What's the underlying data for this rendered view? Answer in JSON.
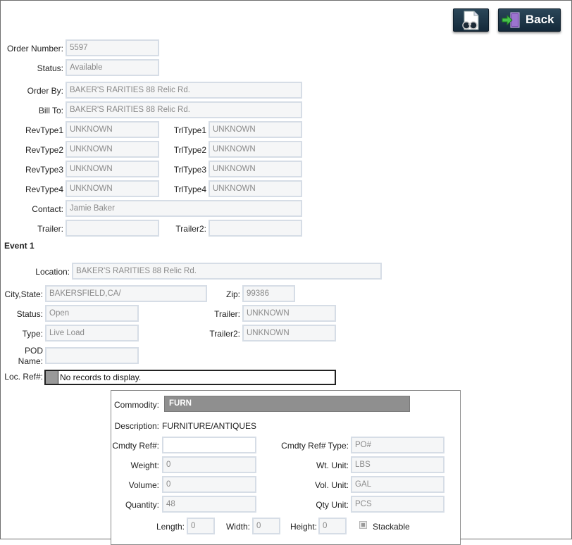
{
  "toolbar": {
    "view_icon": "binoculars-document-icon",
    "back_label": "Back",
    "back_icon": "exit-door-icon"
  },
  "order": {
    "order_number": {
      "label": "Order Number:",
      "value": "5597"
    },
    "status": {
      "label": "Status:",
      "value": "Available"
    },
    "order_by": {
      "label": "Order By:",
      "value": "BAKER'S RARITIES 88 Relic Rd."
    },
    "bill_to": {
      "label": "Bill To:",
      "value": "BAKER'S RARITIES 88 Relic Rd."
    },
    "revtype1": {
      "label": "RevType1",
      "value": "UNKNOWN"
    },
    "revtype2": {
      "label": "RevType2",
      "value": "UNKNOWN"
    },
    "revtype3": {
      "label": "RevType3",
      "value": "UNKNOWN"
    },
    "revtype4": {
      "label": "RevType4",
      "value": "UNKNOWN"
    },
    "trltype1": {
      "label": "TrlType1",
      "value": "UNKNOWN"
    },
    "trltype2": {
      "label": "TrlType2",
      "value": "UNKNOWN"
    },
    "trltype3": {
      "label": "TrlType3",
      "value": "UNKNOWN"
    },
    "trltype4": {
      "label": "TrlType4",
      "value": "UNKNOWN"
    },
    "contact": {
      "label": "Contact:",
      "value": "Jamie Baker"
    },
    "trailer": {
      "label": "Trailer:",
      "value": ""
    },
    "trailer2": {
      "label": "Trailer2:",
      "value": ""
    }
  },
  "event": {
    "title": "Event 1",
    "location": {
      "label": "Location:",
      "value": "BAKER'S RARITIES 88 Relic Rd."
    },
    "city_state": {
      "label": "City,State:",
      "value": "BAKERSFIELD,CA/"
    },
    "zip": {
      "label": "Zip:",
      "value": "99386"
    },
    "status": {
      "label": "Status:",
      "value": "Open"
    },
    "trailer": {
      "label": "Trailer:",
      "value": "UNKNOWN"
    },
    "type": {
      "label": "Type:",
      "value": "Live Load"
    },
    "trailer2": {
      "label": "Trailer2:",
      "value": "UNKNOWN"
    },
    "pod_name": {
      "label_line1": "POD",
      "label_line2": "Name:",
      "value": ""
    },
    "loc_ref": {
      "label": "Loc. Ref#:",
      "empty_message": "No records to display."
    }
  },
  "commodity": {
    "commodity": {
      "label": "Commodity:",
      "value": "FURN"
    },
    "description": {
      "label": "Description:",
      "value": "FURNITURE/ANTIQUES"
    },
    "cmdty_ref": {
      "label": "Cmdty Ref#:",
      "value": ""
    },
    "cmdty_ref_type": {
      "label": "Cmdty Ref# Type:",
      "value": "PO#"
    },
    "weight": {
      "label": "Weight:",
      "value": "0"
    },
    "wt_unit": {
      "label": "Wt. Unit:",
      "value": "LBS"
    },
    "volume": {
      "label": "Volume:",
      "value": "0"
    },
    "vol_unit": {
      "label": "Vol. Unit:",
      "value": "GAL"
    },
    "quantity": {
      "label": "Quantity:",
      "value": "48"
    },
    "qty_unit": {
      "label": "Qty Unit:",
      "value": "PCS"
    },
    "length": {
      "label": "Length:",
      "value": "0"
    },
    "width": {
      "label": "Width:",
      "value": "0"
    },
    "height": {
      "label": "Height:",
      "value": "0"
    },
    "stackable": {
      "label": "Stackable",
      "checked": true
    }
  }
}
